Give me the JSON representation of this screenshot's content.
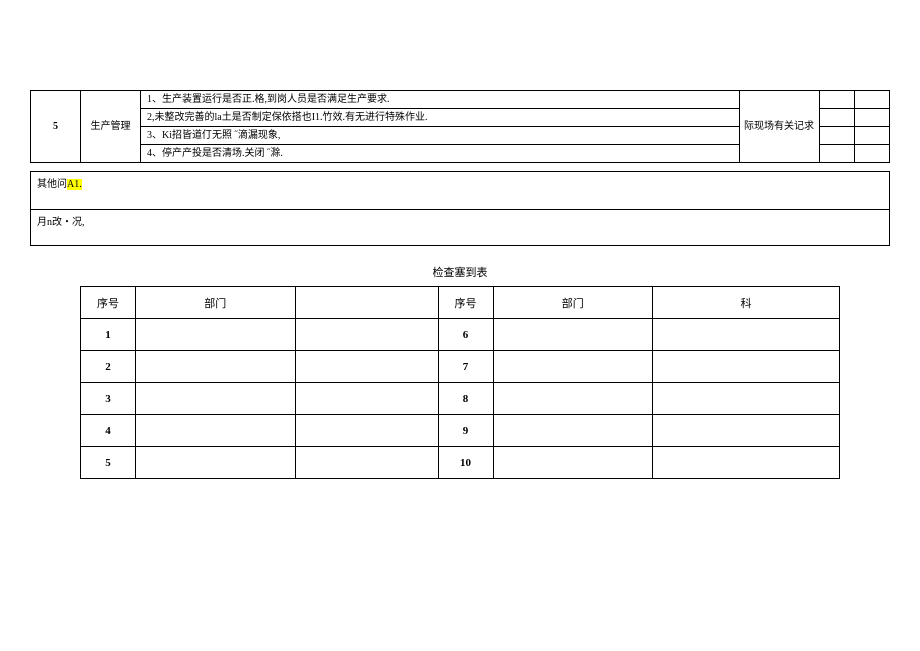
{
  "top_table": {
    "seq": "5",
    "category": "生产管理",
    "items": [
      "1、生产装置运行是否正.格,到岗人员是否满足生产要求.",
      "2,未整改完善的la土是否制定保依搭也I1.竹效.有无进行特殊作业.",
      "3、Ki招皆道仃无照 ˝滴漏现象,",
      "4、停产产投是否清场.关闭 ˝滁."
    ],
    "note_label": "际现场有关记求"
  },
  "notes": {
    "row1_prefix": "其他问",
    "row1_highlight": "A1.",
    "row2": "月n改・况,"
  },
  "section_title": "检查塞到表",
  "signin": {
    "headers": {
      "seq": "序号",
      "dept": "部门",
      "last": "科"
    },
    "left_seq": [
      "1",
      "2",
      "3",
      "4",
      "5"
    ],
    "right_seq": [
      "6",
      "7",
      "8",
      "9",
      "10"
    ]
  }
}
